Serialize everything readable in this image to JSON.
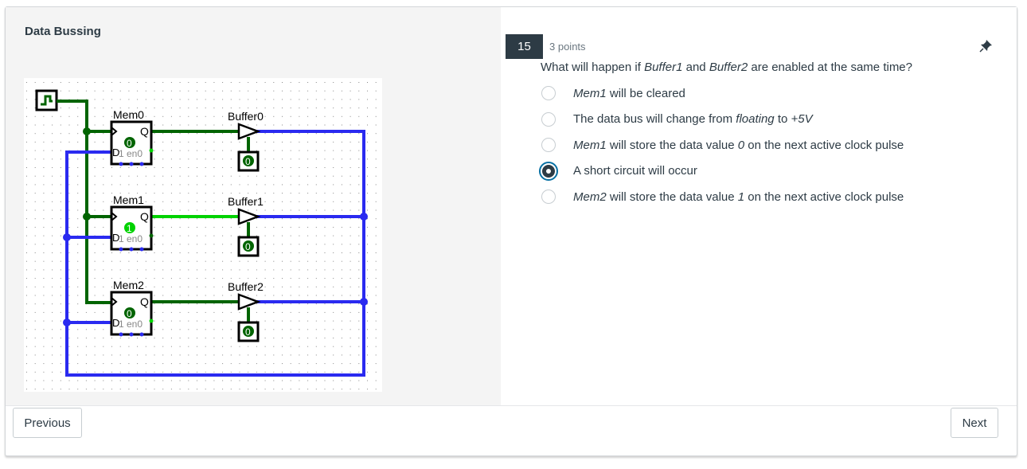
{
  "left": {
    "title": "Data Bussing",
    "circuit": {
      "clock_label": "clock",
      "memories": [
        {
          "label": "Mem0",
          "value": "0",
          "q_pin": "Q",
          "d_pin": "D",
          "sub": "1 en0",
          "active": false
        },
        {
          "label": "Mem1",
          "value": "1",
          "q_pin": "Q",
          "d_pin": "D",
          "sub": "1 en0",
          "active": true
        },
        {
          "label": "Mem2",
          "value": "0",
          "q_pin": "Q",
          "d_pin": "D",
          "sub": "1 en0",
          "active": false
        }
      ],
      "buffers": [
        {
          "label": "Buffer0",
          "enable": "0"
        },
        {
          "label": "Buffer1",
          "enable": "0"
        },
        {
          "label": "Buffer2",
          "enable": "0"
        }
      ],
      "colors": {
        "wire_low": "#006400",
        "wire_high": "#00d200",
        "bus": "#2a2af0",
        "component": "#000000"
      }
    }
  },
  "question": {
    "number": "15",
    "points": "3 points",
    "text_parts": [
      "What will happen if ",
      "Buffer1",
      " and ",
      "Buffer2",
      " are enabled at the same time?"
    ],
    "answers": [
      {
        "parts": [
          {
            "t": "Mem1",
            "i": true
          },
          {
            "t": " will be cleared",
            "i": false
          }
        ],
        "selected": false
      },
      {
        "parts": [
          {
            "t": "The data bus will change from ",
            "i": false
          },
          {
            "t": "floating",
            "i": true
          },
          {
            "t": " to ",
            "i": false
          },
          {
            "t": "+5V",
            "i": true
          }
        ],
        "selected": false
      },
      {
        "parts": [
          {
            "t": "Mem1",
            "i": true
          },
          {
            "t": " will store the data value ",
            "i": false
          },
          {
            "t": "0",
            "i": true
          },
          {
            "t": " on the next active clock pulse",
            "i": false
          }
        ],
        "selected": false
      },
      {
        "parts": [
          {
            "t": "A short circuit will occur",
            "i": false
          }
        ],
        "selected": true
      },
      {
        "parts": [
          {
            "t": "Mem2",
            "i": true
          },
          {
            "t": " will store the data value ",
            "i": false
          },
          {
            "t": "1",
            "i": true
          },
          {
            "t": " on the next active clock pulse",
            "i": false
          }
        ],
        "selected": false
      }
    ],
    "pin_icon": "pin-icon"
  },
  "footer": {
    "previous_label": "Previous",
    "next_label": "Next"
  },
  "colors": {
    "accent": "#0770a3",
    "text": "#2d3b45",
    "badge_bg": "#2d3b45"
  }
}
